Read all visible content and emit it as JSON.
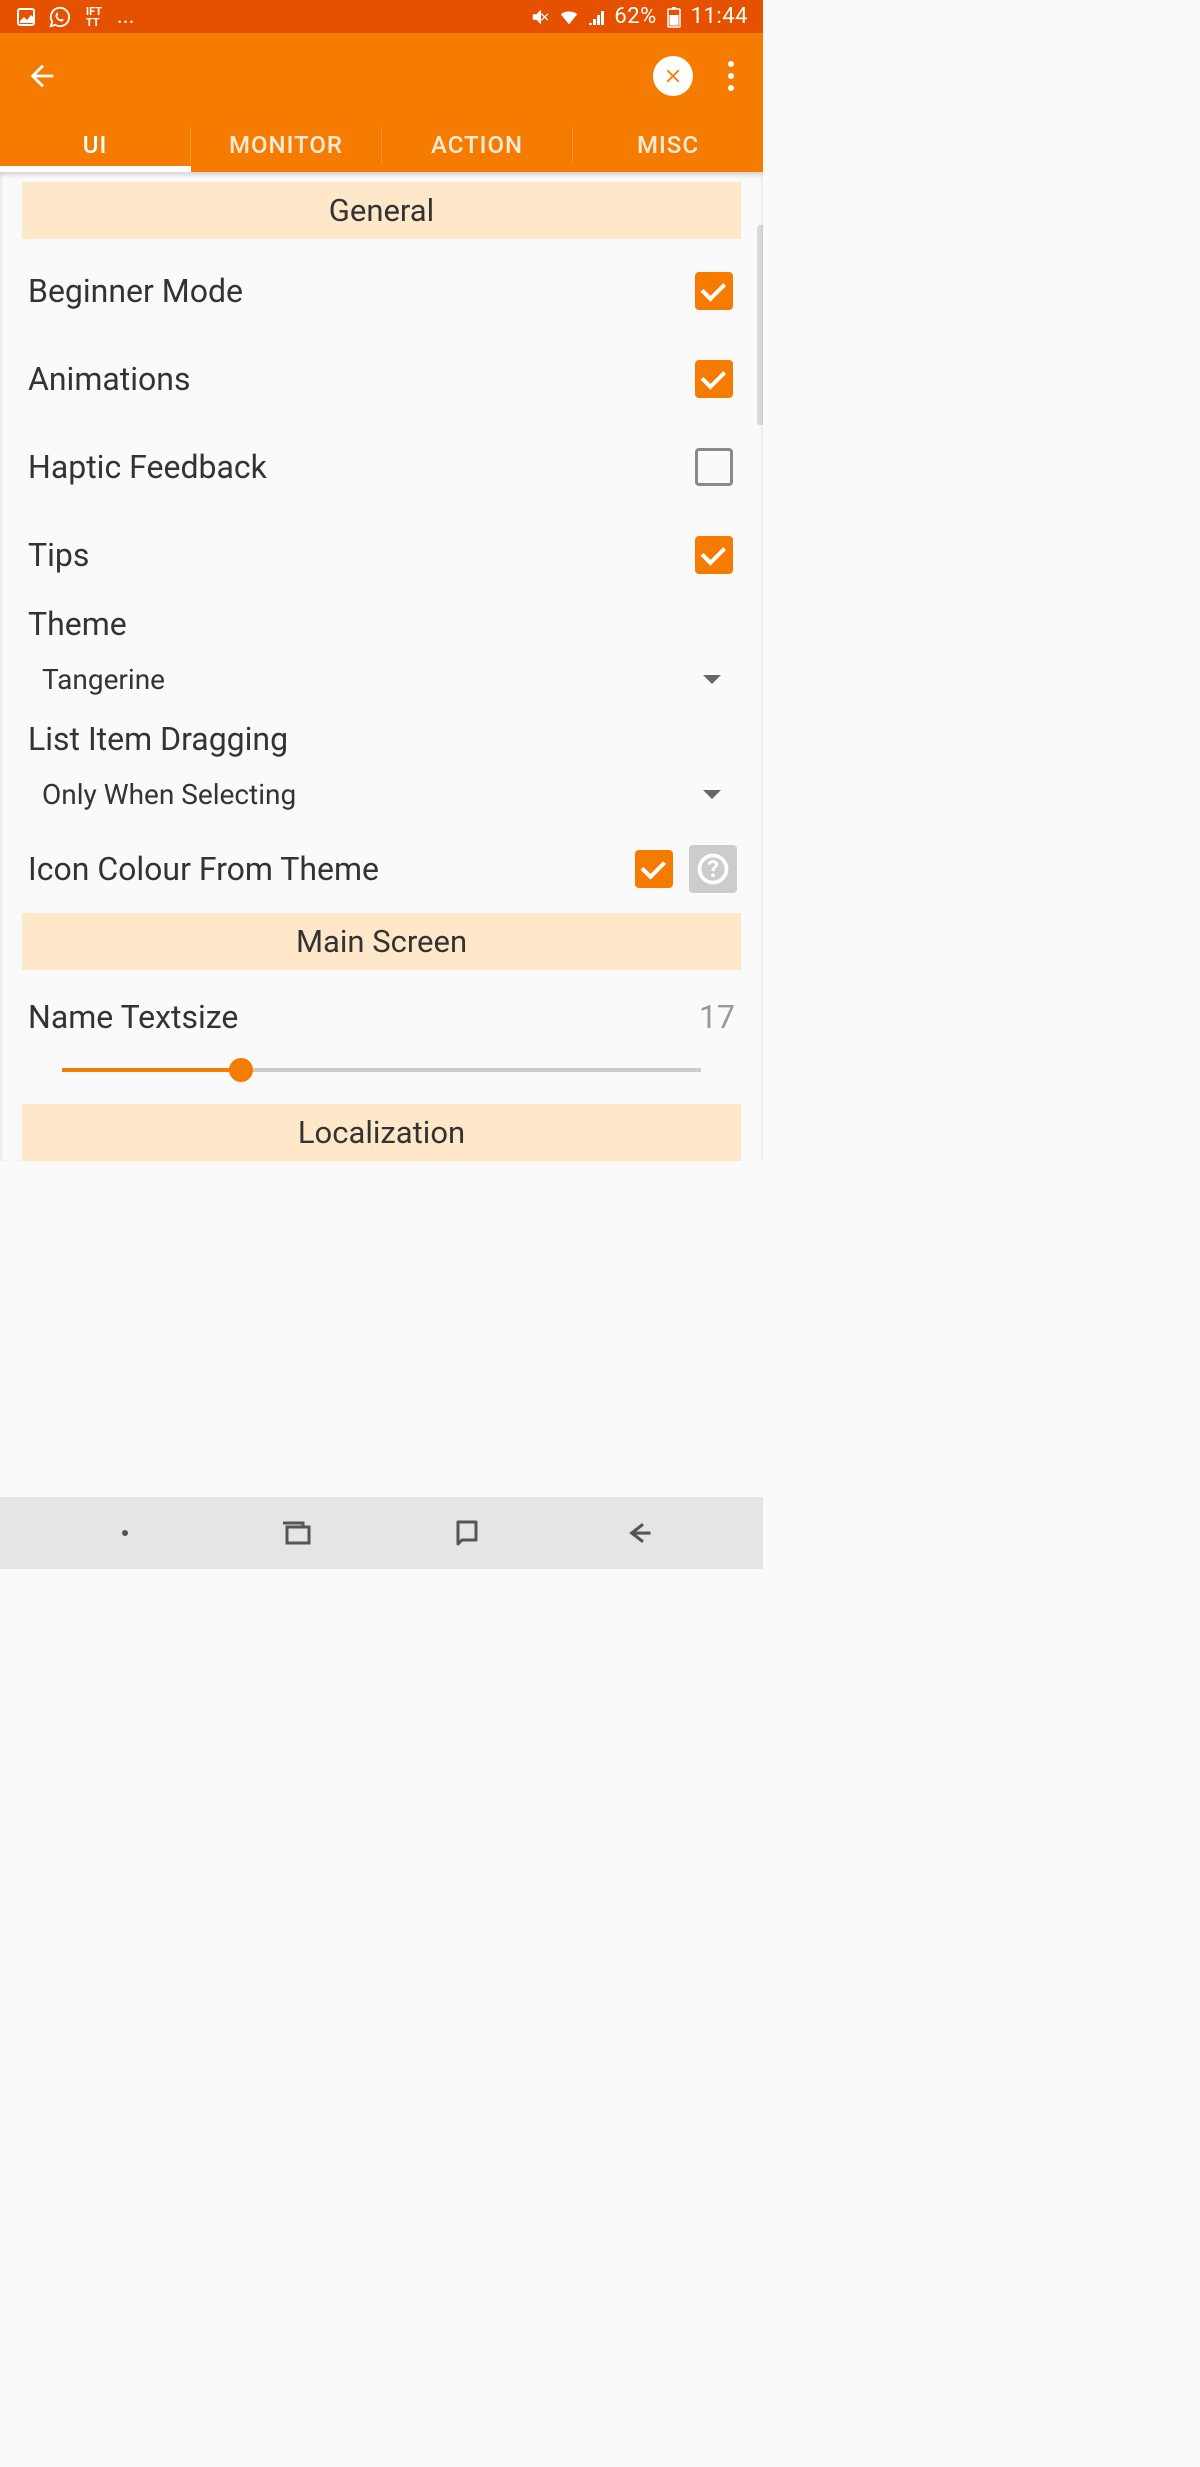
{
  "status": {
    "battery": "62%",
    "time": "11:44"
  },
  "tabs": [
    {
      "label": "UI"
    },
    {
      "label": "MONITOR"
    },
    {
      "label": "ACTION"
    },
    {
      "label": "MISC"
    }
  ],
  "sections": {
    "general": {
      "title": "General",
      "beginnerMode": "Beginner Mode",
      "animations": "Animations",
      "hapticFeedback": "Haptic Feedback",
      "tips": "Tips",
      "theme": {
        "label": "Theme",
        "value": "Tangerine"
      },
      "listDragging": {
        "label": "List Item Dragging",
        "value": "Only When Selecting"
      },
      "iconColour": "Icon Colour From Theme"
    },
    "mainScreen": {
      "title": "Main Screen",
      "nameTextsize": {
        "label": "Name Textsize",
        "value": "17"
      }
    },
    "localization": {
      "title": "Localization"
    }
  }
}
